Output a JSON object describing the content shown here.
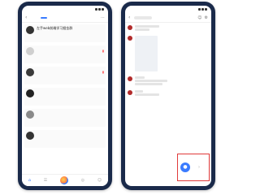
{
  "left_phone": {
    "status": {
      "time": "",
      "icons": [
        "signal-icon",
        "wifi-icon",
        "battery-icon"
      ]
    },
    "nav": {
      "back_icon": "chevron-left-icon",
      "tabs": [
        {
          "label": "",
          "active": false
        },
        {
          "label": "",
          "active": true
        },
        {
          "label": "",
          "active": false
        }
      ],
      "right_icon": "more-icon"
    },
    "cards": [
      {
        "title": "左手web前端学习掘金群",
        "sub": "",
        "meta": "",
        "avatar_color": "#333333",
        "badge": false,
        "flag": false
      },
      {
        "title": "",
        "sub": "",
        "meta": "",
        "avatar_color": "#cfcfcf",
        "badge": false,
        "flag": true
      },
      {
        "title": "",
        "sub": "",
        "meta": "",
        "avatar_color": "#3a3a3a",
        "badge": false,
        "flag": true
      },
      {
        "title": "",
        "sub": "",
        "meta": "",
        "avatar_color": "#222222",
        "badge": false,
        "flag": false
      },
      {
        "title": "",
        "sub": "",
        "meta": "",
        "avatar_color": "#8a8a8a",
        "badge": false,
        "flag": false
      },
      {
        "title": "",
        "sub": "",
        "meta": "",
        "avatar_color": "#333333",
        "badge": false,
        "flag": false
      }
    ],
    "bottom_nav": [
      "home-icon",
      "contacts-icon",
      "logo-icon",
      "discover-icon",
      "profile-icon"
    ]
  },
  "right_phone": {
    "status": {
      "time": "",
      "icons": [
        "signal-icon",
        "wifi-icon",
        "battery-icon"
      ]
    },
    "header_icons": [
      "person-icon",
      "settings-icon"
    ],
    "messages": [
      {
        "type": "text",
        "avatar_color": "#b22b2b"
      },
      {
        "type": "image",
        "avatar_color": "#b22b2b"
      },
      {
        "type": "text",
        "avatar_color": "#b22b2b"
      },
      {
        "type": "text",
        "avatar_color": "#b22b2b"
      }
    ],
    "send_icon": "mic-icon",
    "highlight_color": "#e03a3a"
  },
  "colors": {
    "accent": "#3a7bff",
    "phone_frame": "#1a2a4a",
    "alert": "#ff4d4f"
  }
}
